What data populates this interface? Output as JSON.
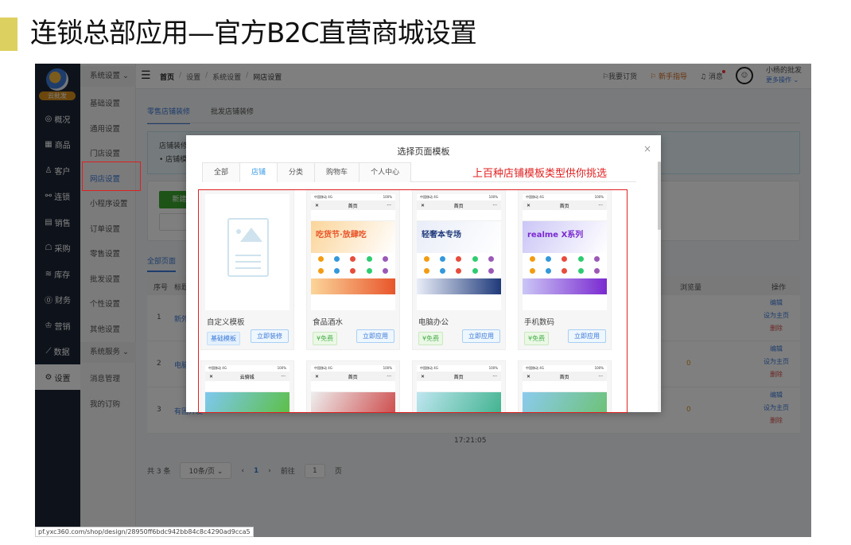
{
  "slide": {
    "title": "连锁总部应用—官方B2C直营商城设置",
    "accent_color": "#dcd160"
  },
  "app": {
    "brand_badge": "云批发",
    "nav": [
      {
        "icon": "compass-icon",
        "glyph": "◎",
        "label": "概况"
      },
      {
        "icon": "grid-icon",
        "glyph": "▦",
        "label": "商品"
      },
      {
        "icon": "user-icon",
        "glyph": "♙",
        "label": "客户"
      },
      {
        "icon": "link-icon",
        "glyph": "⚯",
        "label": "连锁"
      },
      {
        "icon": "clipboard-icon",
        "glyph": "▤",
        "label": "销售"
      },
      {
        "icon": "cart-icon",
        "glyph": "☖",
        "label": "采购"
      },
      {
        "icon": "layers-icon",
        "glyph": "≋",
        "label": "库存"
      },
      {
        "icon": "yuan-icon",
        "glyph": "⓪",
        "label": "财务"
      },
      {
        "icon": "crown-icon",
        "glyph": "♔",
        "label": "营销"
      },
      {
        "icon": "chart-icon",
        "glyph": "⟋",
        "label": "数据"
      },
      {
        "icon": "gear-icon",
        "glyph": "⚙",
        "label": "设置"
      }
    ],
    "subnav": {
      "group1": "系统设置",
      "items1": [
        "基础设置",
        "通用设置",
        "门店设置",
        "网店设置",
        "小程序设置",
        "订单设置",
        "零售设置",
        "批发设置",
        "个性设置",
        "其他设置"
      ],
      "group2": "系统服务",
      "items2": [
        "消息管理",
        "我的订购"
      ],
      "active": "网店设置"
    },
    "breadcrumb": [
      "首页",
      "设置",
      "系统设置",
      "网店设置"
    ],
    "topbar": {
      "order": "我要订货",
      "guide": "新手指导",
      "messages": "消息",
      "username": "小杨的批发",
      "more": "更多操作"
    },
    "tabs": [
      "零售店铺装修",
      "批发店铺装修"
    ],
    "notice_title": "店铺装修",
    "notice_item": "店铺模",
    "new_button": "新建页",
    "all_pages_tab": "全部页面",
    "table": {
      "headers": {
        "index": "序号",
        "title": "标题",
        "views": "浏览量",
        "actions": "操作"
      },
      "rows": [
        {
          "index": "1",
          "title": "新外",
          "views": ""
        },
        {
          "index": "2",
          "title": "电脑",
          "views": "0"
        },
        {
          "index": "3",
          "title": "有固开发",
          "views": "0"
        }
      ],
      "actions": {
        "edit": "编辑",
        "set_home": "设为主页",
        "delete": "删除"
      },
      "timestamp": "17:21:05"
    },
    "pager": {
      "total": "共 3 条",
      "page_size": "10条/页",
      "prev": "‹",
      "current": "1",
      "next": "›",
      "goto_label": "前往",
      "goto_value": "1",
      "page_suffix": "页"
    },
    "status_url": "pf.yxc360.com/shop/design/28950ff6bdc942bb84c8c4290ad9cca5"
  },
  "modal": {
    "title": "选择页面模板",
    "close": "×",
    "tabs": [
      "全部",
      "店铺",
      "分类",
      "购物车",
      "个人中心"
    ],
    "active_tab": "店铺",
    "promo_text": "上百种店铺模板类型供你挑选",
    "templates": [
      {
        "name": "自定义模板",
        "badge": "基础模板",
        "badge_type": "base",
        "button": "立即装修",
        "banner": ""
      },
      {
        "name": "食品酒水",
        "badge": "¥免费",
        "badge_type": "free",
        "button": "立即应用",
        "banner": "吃货节·放肆吃"
      },
      {
        "name": "电脑办公",
        "badge": "¥免费",
        "badge_type": "free",
        "button": "立即应用",
        "banner": "轻奢本专场"
      },
      {
        "name": "手机数码",
        "badge": "¥免费",
        "badge_type": "free",
        "button": "立即应用",
        "banner": "realme X系列"
      }
    ],
    "row2_titles": [
      "云骑城",
      "首页",
      "首页",
      "首页"
    ],
    "phone_status": {
      "carrier": "中国移动 4G",
      "battery": "100%"
    },
    "phone_nav_title": "首页"
  }
}
